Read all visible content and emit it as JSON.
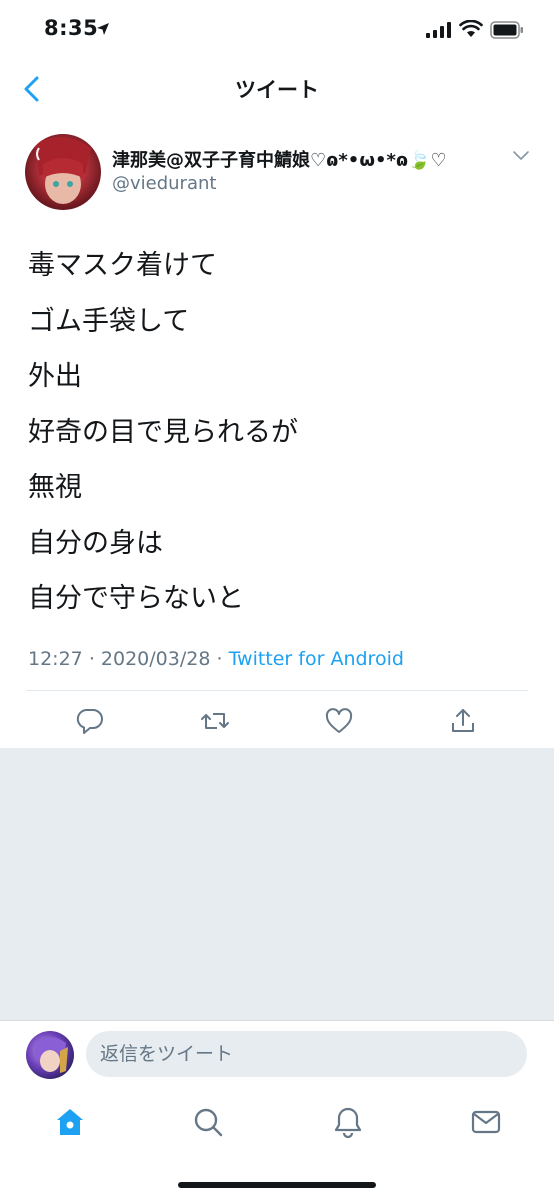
{
  "status_bar": {
    "time": "8:35"
  },
  "nav": {
    "title": "ツイート"
  },
  "tweet": {
    "display_name": "津那美@双子子育中鯖娘♡ɷ*•ω•*ɷ🍃♡",
    "username": "@viedurant",
    "lines": [
      "毒マスク着けて",
      "ゴム手袋して",
      "外出",
      "好奇の目で見られるが",
      "無視",
      "自分の身は",
      "自分で守らないと"
    ],
    "time": "12:27",
    "date": "2020/03/28",
    "separator": "·",
    "source": "Twitter for Android"
  },
  "reply": {
    "placeholder": "返信をツイート"
  },
  "colors": {
    "accent": "#1da1f2",
    "secondary_text": "#657786",
    "gray_background": "#e6ecf0"
  },
  "icons": {
    "back": "chevron-left-icon",
    "caret": "chevron-down-icon",
    "actions": [
      "reply-icon",
      "retweet-icon",
      "like-icon",
      "share-icon"
    ],
    "tabs": [
      "home-icon",
      "search-icon",
      "notifications-icon",
      "messages-icon"
    ]
  }
}
